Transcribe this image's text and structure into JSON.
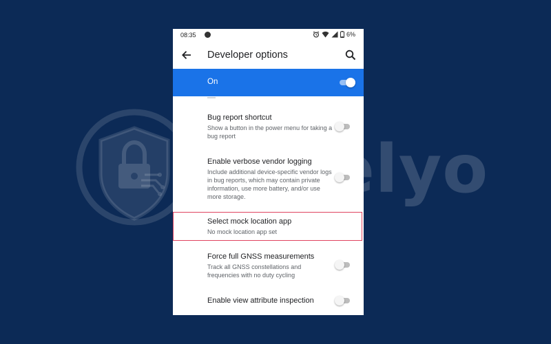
{
  "watermark": {
    "brand_text": "Safelyo",
    "icon": "shield-lock-icon"
  },
  "status_bar": {
    "time": "08:35",
    "battery": "6%",
    "icons": [
      "app-notification-icon",
      "alarm-icon",
      "wifi-icon",
      "signal-icon",
      "battery-icon"
    ]
  },
  "app_bar": {
    "title": "Developer options",
    "back_icon": "arrow-back-icon",
    "search_icon": "search-icon"
  },
  "master_switch": {
    "label": "On",
    "checked": true,
    "accent": "#1a73e8"
  },
  "settings": [
    {
      "title": "Bug report shortcut",
      "summary": "Show a button in the power menu for taking a bug report",
      "has_toggle": true,
      "checked": false
    },
    {
      "title": "Enable verbose vendor logging",
      "summary": "Include additional device-specific vendor logs in bug reports, which may contain private information, use more battery, and/or use more storage.",
      "has_toggle": true,
      "checked": false
    },
    {
      "title": "Select mock location app",
      "summary": "No mock location app set",
      "has_toggle": false,
      "highlighted": true,
      "highlight_color": "#e0435f"
    },
    {
      "title": "Force full GNSS measurements",
      "summary": "Track all GNSS constellations and frequencies with no duty cycling",
      "has_toggle": true,
      "checked": false
    },
    {
      "title": "Enable view attribute inspection",
      "summary": "",
      "has_toggle": true,
      "checked": false
    }
  ],
  "colors": {
    "background": "#0c2a56",
    "screen": "#ffffff"
  }
}
